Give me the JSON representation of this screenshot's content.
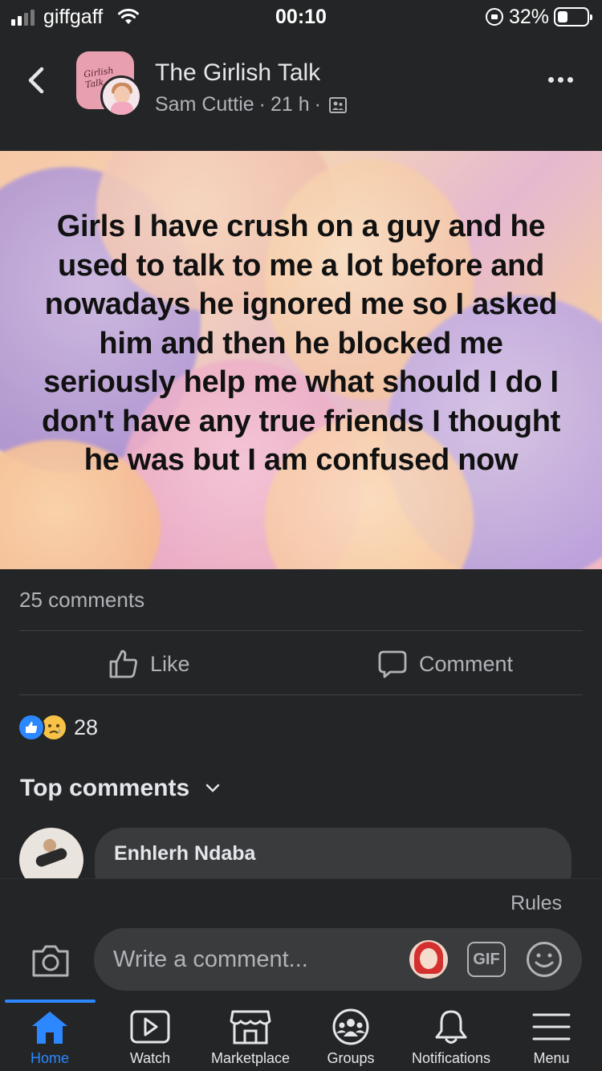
{
  "status_bar": {
    "carrier": "giffgaff",
    "time": "00:10",
    "battery_percent": "32%"
  },
  "header": {
    "group_name": "The Girlish Talk",
    "author": "Sam Cuttie",
    "separator": "·",
    "time_ago": "21 h",
    "separator2": "·",
    "avatar_script_text": "Girlish Talk"
  },
  "post": {
    "text": "Girls I have crush on a guy and he used to talk to me a lot before and nowadays he ignored me so I asked him and then he blocked me seriously help me what should I do I don't have any true friends I thought he was but I am confused now"
  },
  "engagement": {
    "comments_count": "25 comments",
    "like_label": "Like",
    "comment_label": "Comment",
    "reaction_count": "28"
  },
  "comments": {
    "section_title": "Top comments",
    "first_commenter": "Enhlerh Ndaba"
  },
  "composer": {
    "rules_label": "Rules",
    "placeholder": "Write a comment...",
    "gif_label": "GIF"
  },
  "tabs": [
    {
      "label": "Home",
      "icon": "home-icon",
      "active": true
    },
    {
      "label": "Watch",
      "icon": "watch-icon",
      "active": false
    },
    {
      "label": "Marketplace",
      "icon": "marketplace-icon",
      "active": false
    },
    {
      "label": "Groups",
      "icon": "groups-icon",
      "active": false
    },
    {
      "label": "Notifications",
      "icon": "bell-icon",
      "active": false
    },
    {
      "label": "Menu",
      "icon": "menu-icon",
      "active": false
    }
  ],
  "colors": {
    "background": "#242526",
    "accent": "#2d88ff",
    "secondary_text": "#b0b3b8",
    "bubble": "#3a3b3c"
  }
}
